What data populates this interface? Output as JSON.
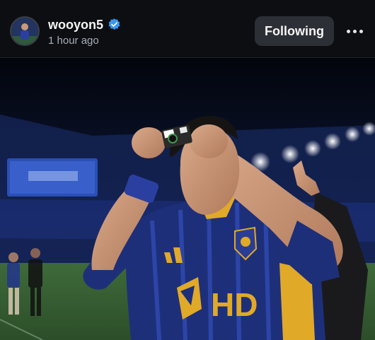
{
  "post": {
    "username": "wooyon5",
    "time_ago": "1 hour ago",
    "follow_label": "Following",
    "verified": true
  },
  "photo": {
    "jersey_sponsor": "HD"
  },
  "colors": {
    "header_bg": "#0c0e12",
    "button_bg": "#2c2f35",
    "verified_blue": "#3897f0",
    "jersey_blue": "#1e2f7a",
    "jersey_gold": "#e0a928"
  },
  "icons": [
    "verified-badge-icon",
    "more-options-icon"
  ]
}
